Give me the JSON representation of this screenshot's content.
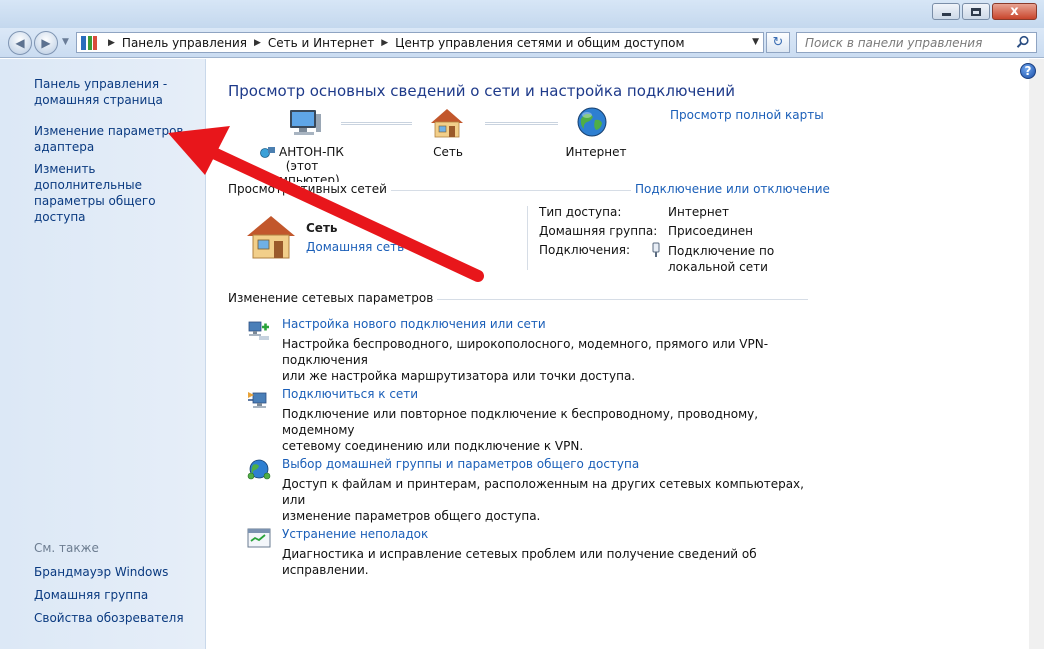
{
  "titlebar": {
    "minimize_label": "",
    "maximize_label": "",
    "close_label": "x"
  },
  "navbar": {
    "breadcrumbs": [
      "Панель управления",
      "Сеть и Интернет",
      "Центр управления сетями и общим доступом"
    ],
    "search_placeholder": "Поиск в панели управления"
  },
  "sidebar": {
    "items": [
      {
        "label": "Панель управления - домашняя страница",
        "line1": "Панель управления -",
        "line2": "домашняя страница"
      },
      {
        "label": "Изменение параметров адаптера",
        "line1": "Изменение параметров",
        "line2": "адаптера"
      },
      {
        "label": "Изменить дополнительные параметры общего доступа",
        "line1": "Изменить дополнительные",
        "line2": "параметры общего доступа"
      }
    ],
    "see_also_title": "См. также",
    "see_also": [
      "Брандмауэр Windows",
      "Домашняя группа",
      "Свойства обозревателя"
    ]
  },
  "main": {
    "title": "Просмотр основных сведений о сети и настройка подключений",
    "full_map_link": "Просмотр полной карты",
    "network_map": {
      "computer_name": "АНТОН-ПК",
      "computer_sub": "(этот компьютер)",
      "network": "Сеть",
      "internet": "Интернет"
    },
    "active_networks": {
      "header": "Просмотр активных сетей",
      "header_visible_tail": "ктивных сетей",
      "header_visible_head": "Просмотр",
      "connect_link": "Подключение или отключение",
      "network_name": "Сеть",
      "network_type": "Домашняя сеть",
      "access_type_label": "Тип доступа:",
      "access_type_value": "Интернет",
      "homegroup_label": "Домашняя группа:",
      "homegroup_value": "Присоединен",
      "connections_label": "Подключения:",
      "connections_value_line1": "Подключение по",
      "connections_value_line2": "локальной сети"
    },
    "change_settings": {
      "header": "Изменение сетевых параметров",
      "tasks": [
        {
          "link": "Настройка нового подключения или сети",
          "desc1": "Настройка беспроводного, широкополосного, модемного, прямого или VPN-подключения",
          "desc2": "или же настройка маршрутизатора или точки доступа."
        },
        {
          "link": "Подключиться к сети",
          "desc1": "Подключение или повторное подключение к беспроводному, проводному, модемному",
          "desc2": "сетевому соединению или подключение к VPN."
        },
        {
          "link": "Выбор домашней группы и параметров общего доступа",
          "desc1": "Доступ к файлам и принтерам, расположенным на других сетевых компьютерах, или",
          "desc2": "изменение параметров общего доступа."
        },
        {
          "link": "Устранение неполадок",
          "desc1": "Диагностика и исправление сетевых проблем или получение сведений об исправлении.",
          "desc2": ""
        }
      ]
    }
  },
  "colors": {
    "link": "#1b5fb8",
    "title": "#1e3a8a",
    "annotation_arrow": "#e8161b"
  }
}
